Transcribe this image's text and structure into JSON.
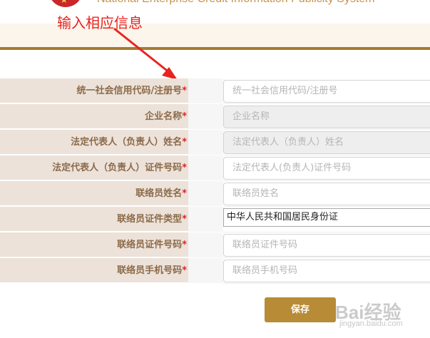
{
  "header": {
    "site_title": "National Enterprise Credit Information Publicity System",
    "annotation": "输入相应信息"
  },
  "form": {
    "rows": [
      {
        "label": "统一社会信用代码/注册号",
        "required": "*",
        "placeholder": "统一社会信用代码/注册号"
      },
      {
        "label": "企业名称",
        "required": "*",
        "placeholder": "企业名称"
      },
      {
        "label": "法定代表人（负责人）姓名",
        "required": "*",
        "placeholder": "法定代表人（负责人）姓名"
      },
      {
        "label": "法定代表人（负责人）证件号码",
        "required": "*",
        "placeholder": "法定代表人(负责人)证件号码"
      },
      {
        "label": "联络员姓名",
        "required": "*",
        "placeholder": "联络员姓名"
      },
      {
        "label": "联络员证件类型",
        "required": "*",
        "value": "中华人民共和国居民身份证"
      },
      {
        "label": "联络员证件号码",
        "required": "*",
        "placeholder": "联络员证件号码"
      },
      {
        "label": "联络员手机号码",
        "required": "*",
        "placeholder": "联络员手机号码"
      }
    ],
    "save_label": "保存"
  },
  "watermark": {
    "main": "Bai经验",
    "sub": "jingyan.baidu.com"
  },
  "colors": {
    "label_bg": "#ece2d9",
    "label_text": "#8c6a4a",
    "required": "#d9262b",
    "accent": "#a57b2f",
    "button": "#b88b37",
    "annotation": "#e8231f"
  }
}
